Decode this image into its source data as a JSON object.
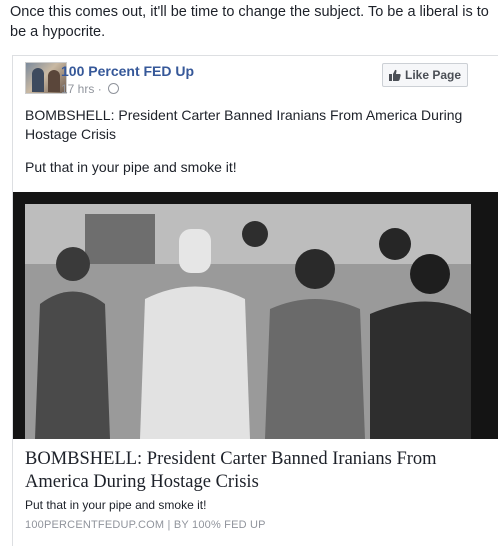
{
  "post": {
    "intro_text": "Once this comes out, it'll be time to change the subject. To be a liberal is to be a hypocrite."
  },
  "shared": {
    "page_name": "100 Percent FED Up",
    "time": "17 hrs",
    "separator": "·",
    "like_button_label": "Like Page",
    "text_line1": "BOMBSHELL: President Carter Banned Iranians From America During Hostage Crisis",
    "text_line2": "Put that in your pipe and smoke it!"
  },
  "link_preview": {
    "title": "BOMBSHELL: President Carter Banned Iranians From America During Hostage Crisis",
    "description": "Put that in your pipe and smoke it!",
    "source": "100PERCENTFEDUP.COM | BY 100% FED UP"
  },
  "icons": {
    "like": "thumbs-up-icon",
    "privacy": "globe-icon"
  }
}
